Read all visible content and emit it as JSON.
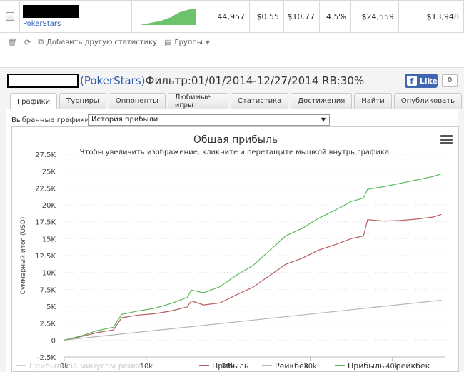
{
  "stats_row": {
    "site": "PokerStars",
    "hands": "44,957",
    "bb_per_hand": "$0.55",
    "avg": "$10.77",
    "rb_pct": "4.5%",
    "total": "$24,559",
    "profit": "$13,948"
  },
  "toolbar": {
    "add_stat_label": "Добавить другую статистику",
    "groups_label": "Группы"
  },
  "panel": {
    "site_label": "(PokerStars)",
    "filter_text": " Фильтр:01/01/2014-12/27/2014 RB:30%",
    "fb_like_label": "Like",
    "fb_count": "0"
  },
  "tabs": [
    {
      "label": "Графики"
    },
    {
      "label": "Турниры"
    },
    {
      "label": "Оппоненты"
    },
    {
      "label": "Любимые игры"
    },
    {
      "label": "Статистика"
    },
    {
      "label": "Достижения"
    },
    {
      "label": "Найти"
    },
    {
      "label": "Опубликовать"
    }
  ],
  "selector": {
    "label": "Выбранные графики:",
    "value": "История прибыли"
  },
  "chart_data": {
    "type": "line",
    "title": "Общая прибыль",
    "subtitle": "Чтобы увеличить изображение, кликните и перетащите мышкой внутрь графика.",
    "ylabel": "Суммарный итог (USD)",
    "xlabel": "",
    "ylim": [
      -2500,
      27500
    ],
    "xlim": [
      0,
      46500
    ],
    "y_ticks": [
      "-2.5K",
      "0",
      "2.5K",
      "5K",
      "7.5K",
      "10K",
      "12.5K",
      "15K",
      "17.5K",
      "20K",
      "22.5K",
      "25K",
      "27.5K"
    ],
    "x_ticks": [
      "0k",
      "10k",
      "20k",
      "30k",
      "40k"
    ],
    "grid": true,
    "legend_position": "bottom",
    "series": [
      {
        "name": "Прибыль + рейкбек",
        "color": "#5cb85c",
        "x": [
          0,
          2000,
          4000,
          6000,
          7000,
          9000,
          11000,
          13000,
          15000,
          15500,
          17000,
          19000,
          21000,
          23000,
          25000,
          27000,
          29000,
          31000,
          33000,
          35000,
          36500,
          37000,
          39000,
          41000,
          43000,
          45000,
          46000
        ],
        "y": [
          0,
          600,
          1400,
          1900,
          3800,
          4300,
          4700,
          5400,
          6300,
          7400,
          7000,
          7900,
          9600,
          11000,
          13200,
          15400,
          16500,
          18000,
          19200,
          20500,
          21000,
          22300,
          22700,
          23200,
          23700,
          24200,
          24600
        ]
      },
      {
        "name": "Прибыль",
        "color": "#b85c5c",
        "x": [
          0,
          2000,
          4000,
          6000,
          7000,
          9000,
          11000,
          13000,
          15000,
          15500,
          17000,
          19000,
          21000,
          23000,
          25000,
          27000,
          29000,
          31000,
          33000,
          35000,
          36500,
          37000,
          39000,
          41000,
          43000,
          45000,
          46000
        ],
        "y": [
          0,
          500,
          1100,
          1500,
          3300,
          3700,
          3900,
          4300,
          4900,
          5800,
          5200,
          5500,
          6700,
          7800,
          9500,
          11200,
          12100,
          13300,
          14100,
          15000,
          15400,
          17800,
          17600,
          17700,
          17900,
          18200,
          18600
        ]
      },
      {
        "name": "Рейкбек",
        "color": "#b5b5b5",
        "x": [
          0,
          46000
        ],
        "y": [
          0,
          5900
        ]
      },
      {
        "name": "Прибыль за минусом рейка",
        "color": "#cfcfcf",
        "x": [],
        "y": []
      }
    ]
  }
}
